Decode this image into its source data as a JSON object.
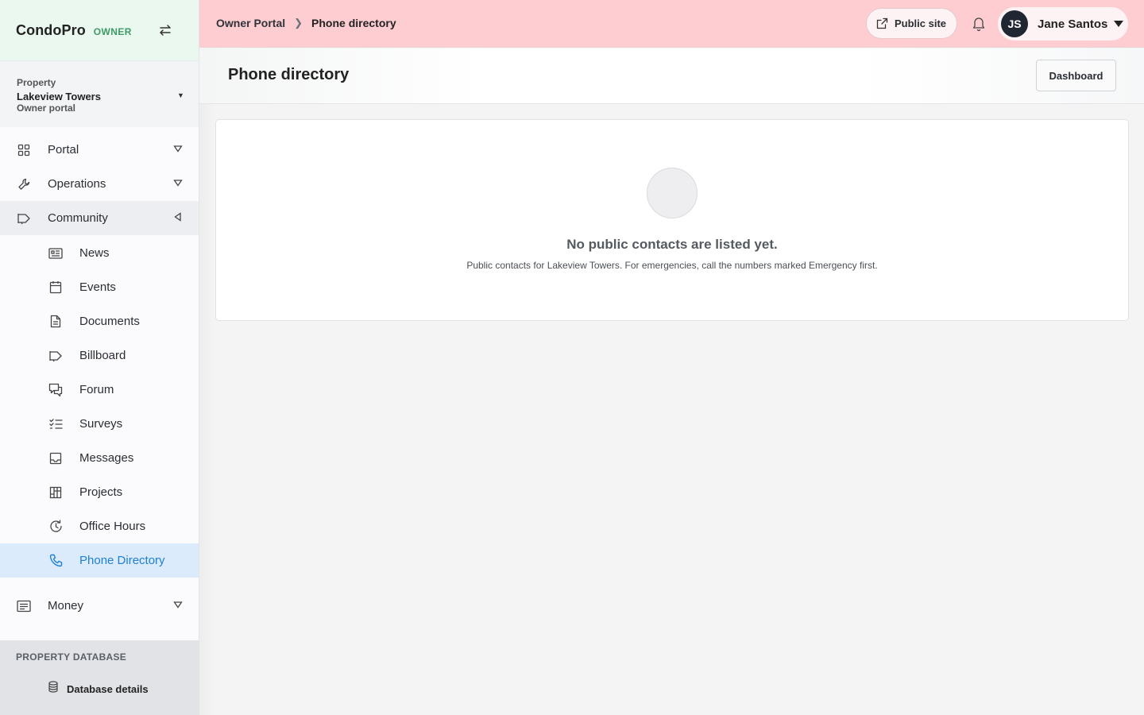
{
  "app": {
    "name": "CondoPro",
    "role": "OWNER"
  },
  "property": {
    "label": "Property",
    "name": "Lakeview Towers",
    "subtitle": "Owner portal"
  },
  "nav": {
    "portal": "Portal",
    "operations": "Operations",
    "community": "Community",
    "money": "Money"
  },
  "community_items": [
    {
      "label": "News",
      "icon": "newspaper-icon"
    },
    {
      "label": "Events",
      "icon": "calendar-icon"
    },
    {
      "label": "Documents",
      "icon": "document-icon"
    },
    {
      "label": "Billboard",
      "icon": "megaphone-icon"
    },
    {
      "label": "Forum",
      "icon": "chat-icon"
    },
    {
      "label": "Surveys",
      "icon": "checklist-icon"
    },
    {
      "label": "Messages",
      "icon": "inbox-icon"
    },
    {
      "label": "Projects",
      "icon": "grid-icon"
    },
    {
      "label": "Office Hours",
      "icon": "clock-icon"
    },
    {
      "label": "Phone Directory",
      "icon": "phone-icon"
    }
  ],
  "db_section": {
    "title": "PROPERTY DATABASE",
    "item": "Database details"
  },
  "header": {
    "breadcrumb_root": "Owner Portal",
    "breadcrumb_current": "Phone directory",
    "public_site": "Public site",
    "user_initials": "JS",
    "user_name": "Jane Santos"
  },
  "page": {
    "title": "Phone directory",
    "dashboard_button": "Dashboard"
  },
  "empty_state": {
    "title": "No public contacts are listed yet.",
    "description": "Public contacts for Lakeview Towers. For emergencies, call the numbers marked Emergency first."
  },
  "colors": {
    "accent": "#1e7fd6",
    "header_bg": "#fdcdd2",
    "brand_bg": "#eaf8f0",
    "role": "#3d9a66"
  }
}
